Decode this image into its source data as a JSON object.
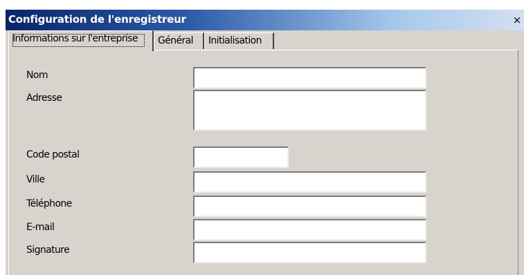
{
  "window": {
    "title": "Configuration de l'enregistreur",
    "close_glyph": "×"
  },
  "tabs": [
    {
      "label": "Informations sur l'entreprise",
      "active": true
    },
    {
      "label": "Général",
      "active": false
    },
    {
      "label": "Initialisation",
      "active": false
    }
  ],
  "form": {
    "fields": [
      {
        "label": "Nom",
        "value": ""
      },
      {
        "label": "Adresse",
        "value": ""
      },
      {
        "label": "Code postal",
        "value": ""
      },
      {
        "label": "Ville",
        "value": ""
      },
      {
        "label": "Téléphone",
        "value": ""
      },
      {
        "label": "E-mail",
        "value": ""
      },
      {
        "label": "Signature",
        "value": ""
      }
    ]
  },
  "colors": {
    "title_bar_start": "#0a246a",
    "title_bar_end": "#d4dff0",
    "window_face": "#d8d4cd",
    "input_background": "#ffffff"
  }
}
